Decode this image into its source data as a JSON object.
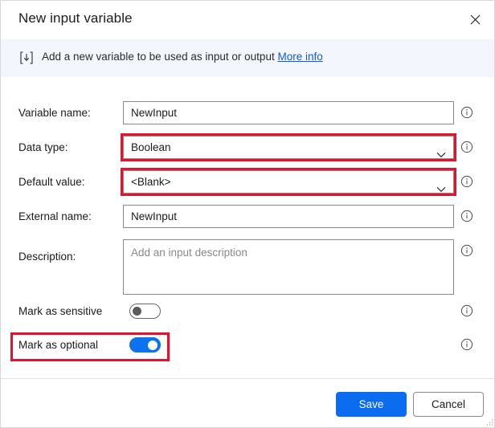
{
  "dialog": {
    "title": "New input variable",
    "close_label": "Close"
  },
  "infobar": {
    "icon": "download-input-icon",
    "text": "Add a new variable to be used as input or output",
    "link_label": "More info"
  },
  "form": {
    "rows": [
      {
        "label": "Variable name:",
        "control": "textbox",
        "value": "NewInput",
        "placeholder": "",
        "highlighted": false
      },
      {
        "label": "Data type:",
        "control": "combobox",
        "value": "Boolean",
        "placeholder": "",
        "highlighted": true
      },
      {
        "label": "Default value:",
        "control": "combobox",
        "value": "<Blank>",
        "placeholder": "",
        "highlighted": true
      },
      {
        "label": "External name:",
        "control": "textbox",
        "value": "NewInput",
        "placeholder": "",
        "highlighted": false
      },
      {
        "label": "Description:",
        "control": "textarea",
        "value": "",
        "placeholder": "Add an input description",
        "highlighted": false
      },
      {
        "label": "Mark as sensitive",
        "control": "toggle",
        "value": "off",
        "highlighted": false
      },
      {
        "label": "Mark as optional",
        "control": "toggle",
        "value": "on",
        "highlighted": true
      }
    ],
    "info_icon_label": "i"
  },
  "footer": {
    "save_label": "Save",
    "cancel_label": "Cancel"
  },
  "colors": {
    "accent": "#0b6cf0",
    "highlight": "#e8112d",
    "link": "#0f5bd7",
    "infobar_bg": "#f3f6fc"
  }
}
